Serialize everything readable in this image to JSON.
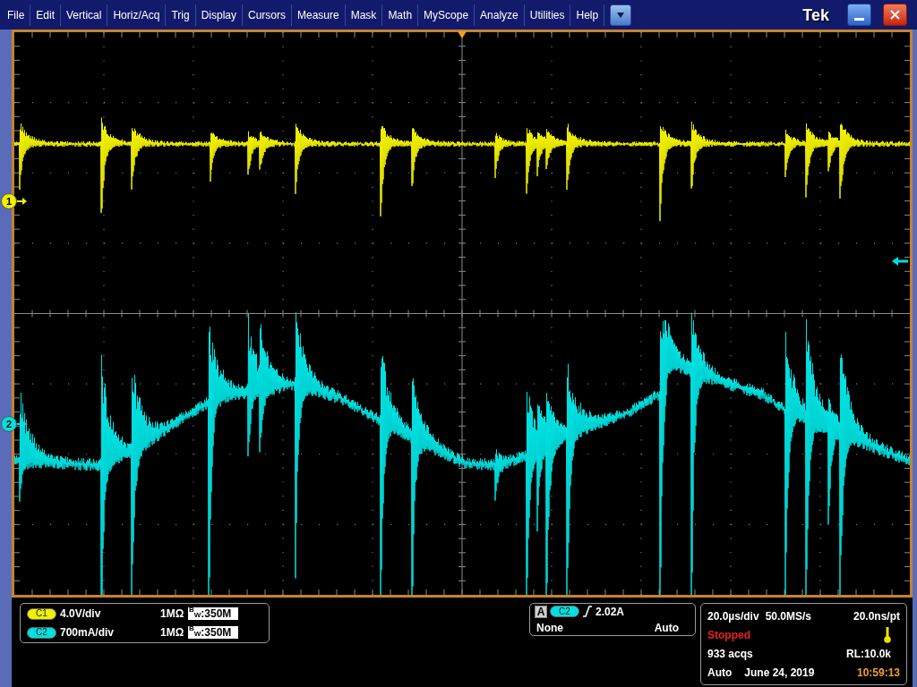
{
  "menu_bar": {
    "items": [
      "File",
      "Edit",
      "Vertical",
      "Horiz/Acq",
      "Trig",
      "Display",
      "Cursors",
      "Measure",
      "Mask",
      "Math",
      "MyScope",
      "Analyze",
      "Utilities",
      "Help"
    ],
    "brand": "Tek"
  },
  "channels": [
    {
      "marker": "1",
      "badge": "C1",
      "color": "#f0f000",
      "scale": "4.0V/div",
      "termination": "1MΩ",
      "bandwidth": "$^{B}$$_{W}$:350M"
    },
    {
      "marker": "2",
      "badge": "C2",
      "color": "#00e0e0",
      "scale": "700mA/div",
      "termination": "1MΩ",
      "bandwidth": "$^{B}$$_{W}$:350M"
    }
  ],
  "trigger": {
    "label": "A",
    "source": "C2",
    "threshold": "2.02A",
    "coupling": "None",
    "mode": "Auto"
  },
  "acquisition": {
    "timebase": "20.0µs/div",
    "sample_rate": "50.0MS/s",
    "resolution": "20.0ns/pt",
    "state": "Stopped",
    "count": "933 acqs",
    "record_length": "RL:10.0k",
    "run_mode": "Auto",
    "date": "June 24, 2019",
    "time": "10:59:13"
  }
}
